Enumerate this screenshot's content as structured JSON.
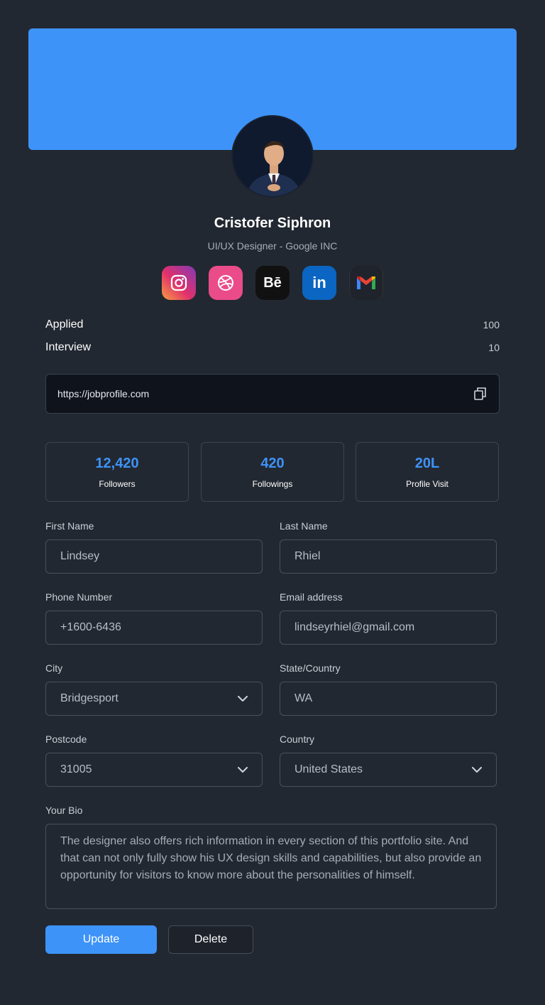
{
  "profile": {
    "name": "Cristofer Siphron",
    "role": "UI/UX Designer - Google INC"
  },
  "socials": [
    {
      "name": "instagram-icon",
      "glyph": ""
    },
    {
      "name": "dribbble-icon",
      "glyph": ""
    },
    {
      "name": "behance-icon",
      "glyph": "Bē"
    },
    {
      "name": "linkedin-icon",
      "glyph": "in"
    },
    {
      "name": "gmail-icon",
      "glyph": ""
    }
  ],
  "stats": {
    "applied_label": "Applied",
    "applied_value": "100",
    "interview_label": "Interview",
    "interview_value": "10"
  },
  "profile_url": "https://jobprofile.com",
  "counters": [
    {
      "value": "12,420",
      "label": "Followers"
    },
    {
      "value": "420",
      "label": "Followings"
    },
    {
      "value": "20L",
      "label": "Profile Visit"
    }
  ],
  "form": {
    "first_name": {
      "label": "First Name",
      "value": "Lindsey"
    },
    "last_name": {
      "label": "Last Name",
      "value": "Rhiel"
    },
    "phone": {
      "label": "Phone Number",
      "value": "+1600-6436"
    },
    "email": {
      "label": "Email address",
      "value": "lindseyrhiel@gmail.com"
    },
    "city": {
      "label": "City",
      "value": "Bridgesport"
    },
    "state": {
      "label": "State/Country",
      "value": "WA"
    },
    "postcode": {
      "label": "Postcode",
      "value": "31005"
    },
    "country": {
      "label": "Country",
      "value": "United States"
    },
    "bio": {
      "label": "Your Bio",
      "value": "The designer also offers rich information in every section of this portfolio site. And that can not only fully show his UX design skills and capabilities, but also provide an opportunity for visitors to know more about the personalities of himself."
    }
  },
  "buttons": {
    "update": "Update",
    "delete": "Delete"
  },
  "colors": {
    "background": "#222831",
    "accent": "#3d93f8"
  }
}
